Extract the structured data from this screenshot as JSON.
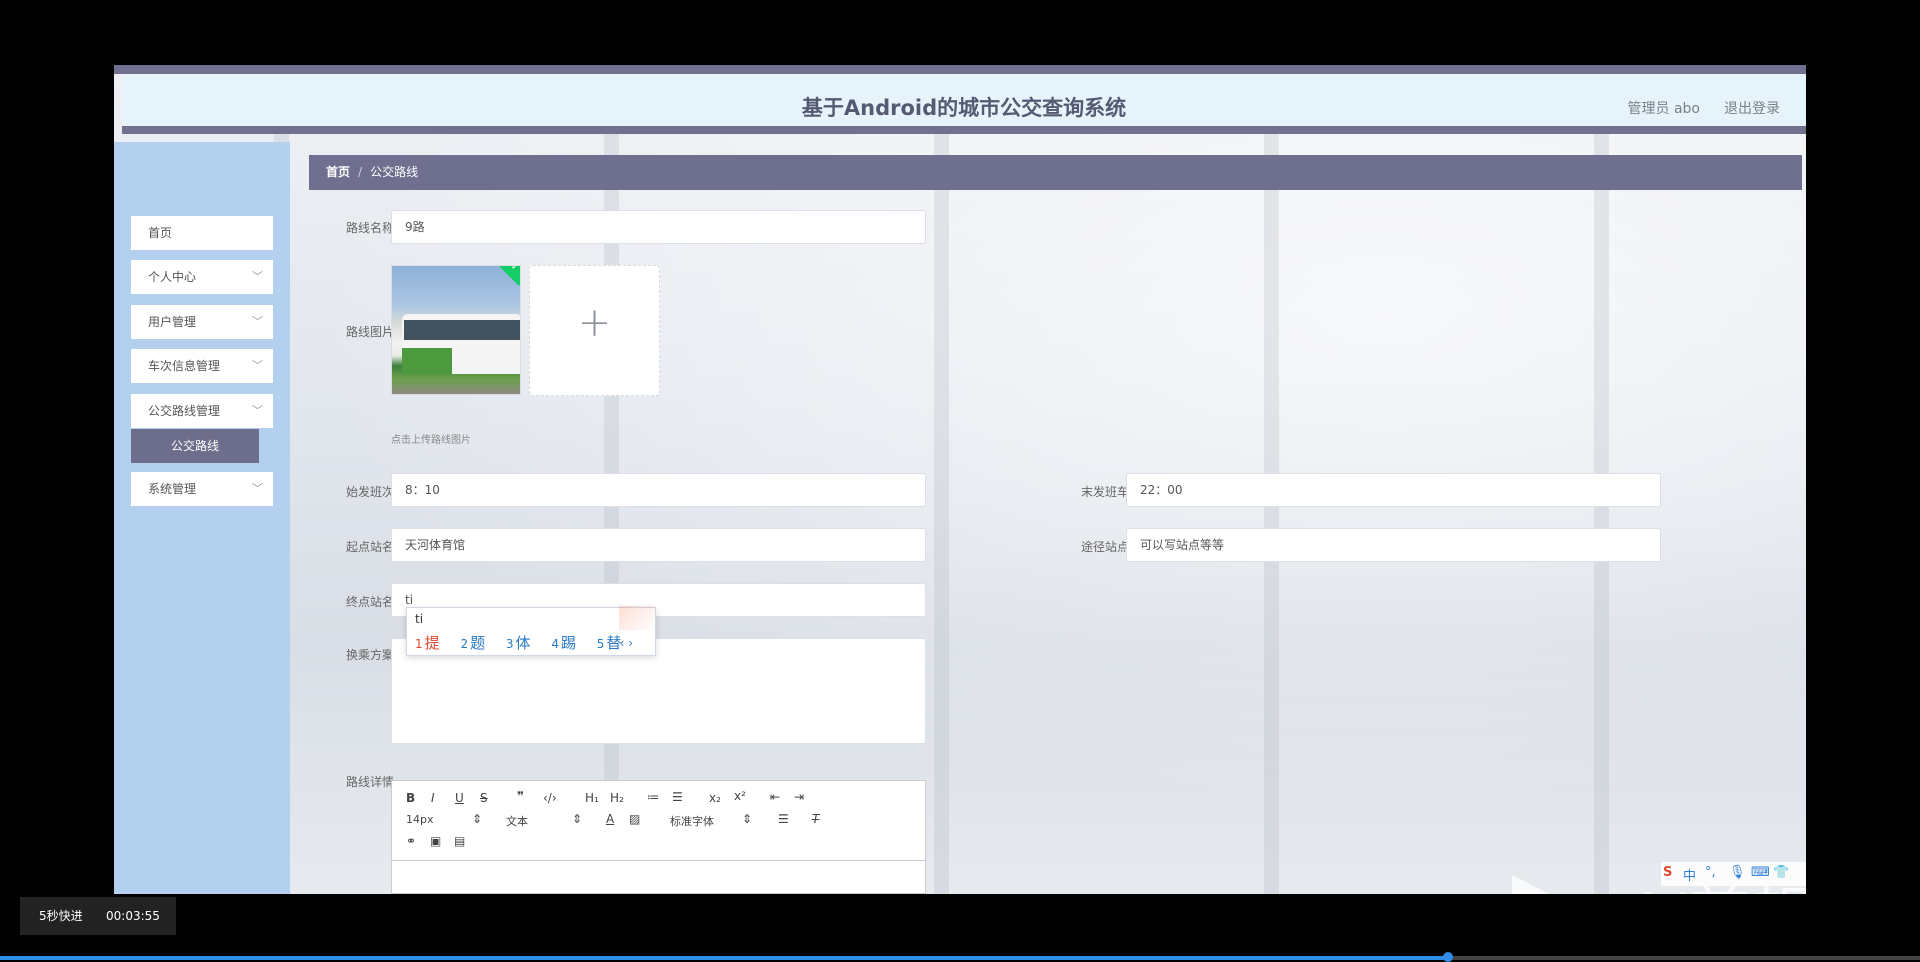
{
  "header": {
    "title": "基于Android的城市公交查询系统",
    "user": "管理员 abo",
    "logout": "退出登录"
  },
  "sidebar": {
    "items": [
      {
        "label": "首页"
      },
      {
        "label": "个人中心"
      },
      {
        "label": "用户管理"
      },
      {
        "label": "车次信息管理"
      },
      {
        "label": "公交路线管理"
      },
      {
        "label": "公交路线"
      },
      {
        "label": "系统管理"
      }
    ]
  },
  "breadcrumb": {
    "home": "首页",
    "separator": "/",
    "current": "公交路线"
  },
  "form": {
    "route_name": {
      "label": "路线名称",
      "value": "9路"
    },
    "route_image": {
      "label": "路线图片",
      "hint": "点击上传路线图片"
    },
    "first_bus": {
      "label": "始发班次",
      "value": "8：10"
    },
    "last_bus": {
      "label": "末发班车",
      "value": "22：00"
    },
    "start_station": {
      "label": "起点站名",
      "value": "天河体育馆"
    },
    "via_stations": {
      "label": "途径站点",
      "value": "可以写站点等等"
    },
    "end_station": {
      "label": "终点站名",
      "value": "ti"
    },
    "transfer": {
      "label": "换乘方案"
    },
    "details": {
      "label": "路线详情"
    }
  },
  "ime": {
    "composition": "ti",
    "candidates": [
      {
        "num": "1",
        "text": "提"
      },
      {
        "num": "2",
        "text": "题"
      },
      {
        "num": "3",
        "text": "体"
      },
      {
        "num": "4",
        "text": "踢"
      },
      {
        "num": "5",
        "text": "替"
      }
    ],
    "nav": "‹ ›"
  },
  "editor": {
    "font_size": "14px",
    "paragraph": "文本",
    "font_family": "标准字体"
  },
  "imebar": {
    "lang": "中",
    "punct": "°,"
  },
  "watermark": {
    "text": "eV剪辑"
  },
  "player": {
    "fast_forward": "5秒快进",
    "time": "00:03:55",
    "progress": 0.754
  },
  "colors": {
    "accent": "#6f6f90",
    "sidebar": "#b3d1ee",
    "header": "#e6f3fb",
    "progress": "#2f8ce8"
  }
}
